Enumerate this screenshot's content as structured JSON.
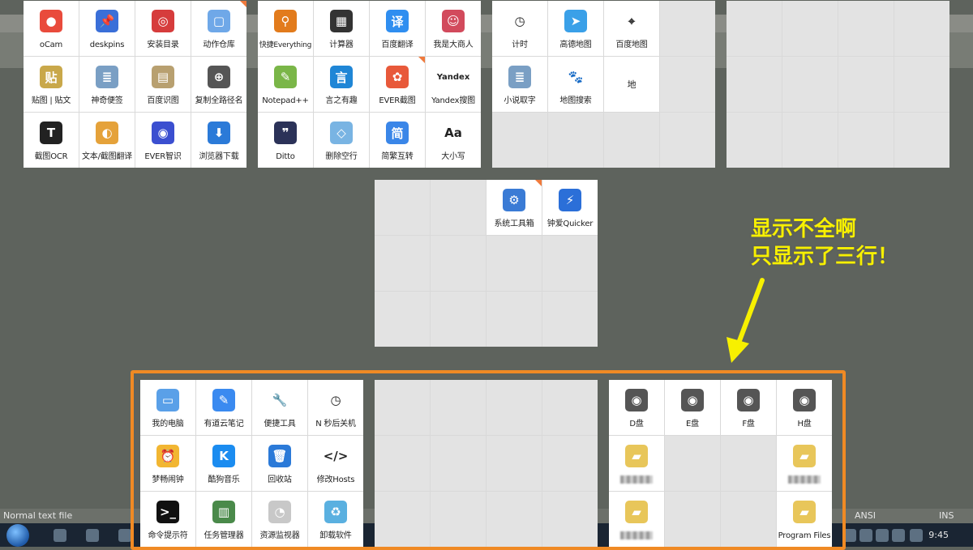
{
  "background": {
    "status_left": "Normal text file",
    "status_ansi": "ANSI",
    "status_ins": "INS",
    "clock": "9:45"
  },
  "panels": [
    {
      "id": "p1",
      "cols": 4,
      "rows": 3,
      "cells": [
        {
          "label": "oCam",
          "icon": "ocam-icon",
          "bg": "#e94b3c",
          "glyph": "●"
        },
        {
          "label": "deskpins",
          "icon": "pin-icon",
          "bg": "#3a6fd8",
          "glyph": "📌"
        },
        {
          "label": "安装目录",
          "icon": "install-icon",
          "bg": "#d63c3c",
          "glyph": "◎"
        },
        {
          "label": "动作仓库",
          "icon": "repo-icon",
          "bg": "#6fa8e8",
          "glyph": "▢",
          "corner": true
        },
        {
          "label": "贴图 | 贴文",
          "icon": "sticker-icon",
          "bg": "#c9a84a",
          "glyph": "贴"
        },
        {
          "label": "神奇便签",
          "icon": "note-icon",
          "bg": "#7a9fc4",
          "glyph": "≣"
        },
        {
          "label": "百度识图",
          "icon": "baidu-image-icon",
          "bg": "#b8a070",
          "glyph": "▤"
        },
        {
          "label": "复制全路径名",
          "icon": "copy-path-icon",
          "bg": "#555",
          "glyph": "⊕"
        },
        {
          "label": "截图OCR",
          "icon": "ocr-icon",
          "bg": "#222",
          "glyph": "T"
        },
        {
          "label": "文本/截图翻译",
          "icon": "translate-icon",
          "bg": "#e5a23a",
          "glyph": "◐"
        },
        {
          "label": "EVER智识",
          "icon": "ever-icon",
          "bg": "#3b4fd0",
          "glyph": "◉"
        },
        {
          "label": "浏览器下载",
          "icon": "download-icon",
          "bg": "#2b7ad8",
          "glyph": "⬇"
        }
      ]
    },
    {
      "id": "p2",
      "cols": 4,
      "rows": 3,
      "cells": [
        {
          "label": "快捷Everything",
          "icon": "everything-icon",
          "bg": "#e27b1c",
          "glyph": "⚲",
          "small": true
        },
        {
          "label": "计算器",
          "icon": "calculator-icon",
          "bg": "#333",
          "glyph": "▦"
        },
        {
          "label": "百度翻译",
          "icon": "baidu-translate-icon",
          "bg": "#2f8ef0",
          "glyph": "译"
        },
        {
          "label": "我是大商人",
          "icon": "merchant-icon",
          "bg": "#d24a5c",
          "glyph": "☺"
        },
        {
          "label": "Notepad++",
          "icon": "notepadpp-icon",
          "bg": "#7ab648",
          "glyph": "✎"
        },
        {
          "label": "言之有趣",
          "icon": "quote-icon",
          "bg": "#1f86d6",
          "glyph": "言"
        },
        {
          "label": "EVER截图",
          "icon": "ever-screenshot-icon",
          "bg": "#e8593a",
          "glyph": "✿",
          "corner": true
        },
        {
          "label": "Yandex搜图",
          "icon": "yandex-icon",
          "bg": "#ffffff",
          "glyph": "Yandex",
          "dark": true
        },
        {
          "label": "Ditto",
          "icon": "ditto-icon",
          "bg": "#2b3258",
          "glyph": "❞"
        },
        {
          "label": "删除空行",
          "icon": "eraser-icon",
          "bg": "#79b4e3",
          "glyph": "◇"
        },
        {
          "label": "简繁互转",
          "icon": "convert-icon",
          "bg": "#3a86e8",
          "glyph": "简"
        },
        {
          "label": "大小写",
          "icon": "case-icon",
          "bg": "#ffffff",
          "glyph": "Aa",
          "dark": true
        }
      ]
    },
    {
      "id": "p3",
      "cols": 4,
      "rows": 3,
      "cells": [
        {
          "label": "计时",
          "icon": "clock-icon",
          "bg": "#ffffff",
          "glyph": "◷",
          "dark": true
        },
        {
          "label": "高德地图",
          "icon": "amap-icon",
          "bg": "#3aa0e8",
          "glyph": "➤"
        },
        {
          "label": "百度地图",
          "icon": "baidu-map-icon",
          "bg": "#ffffff",
          "glyph": "⌖",
          "dark": true
        },
        {
          "empty": true
        },
        {
          "label": "小说取字",
          "icon": "novel-icon",
          "bg": "#7a9fc4",
          "glyph": "≣"
        },
        {
          "label": "地图搜索",
          "icon": "map-search-icon",
          "bg": "#ffffff",
          "glyph": "🐾",
          "dark": true
        },
        {
          "label": "地",
          "textOnly": true
        },
        {
          "empty": true
        },
        {
          "empty": true
        },
        {
          "empty": true
        },
        {
          "empty": true
        },
        {
          "empty": true
        }
      ]
    },
    {
      "id": "p4",
      "cols": 4,
      "rows": 3,
      "cells": [
        {
          "empty": true
        },
        {
          "empty": true
        },
        {
          "empty": true
        },
        {
          "empty": true
        },
        {
          "empty": true
        },
        {
          "empty": true
        },
        {
          "empty": true
        },
        {
          "empty": true
        },
        {
          "empty": true
        },
        {
          "empty": true
        },
        {
          "empty": true
        },
        {
          "empty": true
        }
      ]
    },
    {
      "id": "p5",
      "cols": 4,
      "rows": 3,
      "cells": [
        {
          "empty": true
        },
        {
          "empty": true
        },
        {
          "label": "系统工具箱",
          "icon": "system-tools-icon",
          "bg": "#3a7bd5",
          "glyph": "⚙",
          "corner": true
        },
        {
          "label": "钟爱Quicker",
          "icon": "quicker-icon",
          "bg": "#2b6fd8",
          "glyph": "⚡"
        },
        {
          "empty": true
        },
        {
          "empty": true
        },
        {
          "empty": true
        },
        {
          "empty": true
        },
        {
          "empty": true
        },
        {
          "empty": true
        },
        {
          "empty": true
        },
        {
          "empty": true
        }
      ]
    },
    {
      "id": "p6",
      "cols": 4,
      "rows": 3,
      "cells": [
        {
          "label": "我的电脑",
          "icon": "computer-icon",
          "bg": "#5aa0e8",
          "glyph": "▭"
        },
        {
          "label": "有道云笔记",
          "icon": "youdao-note-icon",
          "bg": "#3a8af0",
          "glyph": "✎"
        },
        {
          "label": "便捷工具",
          "icon": "wrench-icon",
          "bg": "#ffffff",
          "glyph": "🔧",
          "dark": true
        },
        {
          "label": "N 秒后关机",
          "icon": "shutdown-timer-icon",
          "bg": "#ffffff",
          "glyph": "◷",
          "dark": true
        },
        {
          "label": "梦畅闹钟",
          "icon": "alarm-icon",
          "bg": "#f2b632",
          "glyph": "⏰"
        },
        {
          "label": "酷狗音乐",
          "icon": "kugou-icon",
          "bg": "#1b8cf0",
          "glyph": "K"
        },
        {
          "label": "回收站",
          "icon": "recycle-bin-icon",
          "bg": "#2b7ad8",
          "glyph": "🗑"
        },
        {
          "label": "修改Hosts",
          "icon": "hosts-file-icon",
          "bg": "#ffffff",
          "glyph": "</>",
          "dark": true
        },
        {
          "label": "命令提示符",
          "icon": "cmd-icon",
          "bg": "#111",
          "glyph": ">_"
        },
        {
          "label": "任务管理器",
          "icon": "task-manager-icon",
          "bg": "#4a8a4a",
          "glyph": "▥"
        },
        {
          "label": "资源监视器",
          "icon": "resource-monitor-icon",
          "bg": "#c8c8c8",
          "glyph": "◔"
        },
        {
          "label": "卸载软件",
          "icon": "uninstall-icon",
          "bg": "#5ab0e0",
          "glyph": "♻"
        }
      ]
    },
    {
      "id": "p7",
      "cols": 4,
      "rows": 3,
      "cells": [
        {
          "empty": true
        },
        {
          "empty": true
        },
        {
          "empty": true
        },
        {
          "empty": true
        },
        {
          "empty": true
        },
        {
          "empty": true
        },
        {
          "empty": true
        },
        {
          "empty": true
        },
        {
          "empty": true
        },
        {
          "empty": true
        },
        {
          "empty": true
        },
        {
          "empty": true
        }
      ]
    },
    {
      "id": "p8",
      "cols": 4,
      "rows": 3,
      "cells": [
        {
          "label": "D盘",
          "icon": "disk-icon",
          "bg": "#555",
          "glyph": "◉"
        },
        {
          "label": "E盘",
          "icon": "disk-icon",
          "bg": "#555",
          "glyph": "◉"
        },
        {
          "label": "F盘",
          "icon": "disk-icon",
          "bg": "#555",
          "glyph": "◉"
        },
        {
          "label": "H盘",
          "icon": "disk-icon",
          "bg": "#555",
          "glyph": "◉"
        },
        {
          "icon": "folder-icon",
          "bg": "#e8c65a",
          "glyph": "▰",
          "blur": true
        },
        {
          "empty": true
        },
        {
          "empty": true
        },
        {
          "icon": "folder-icon",
          "bg": "#e8c65a",
          "glyph": "▰",
          "blur": true
        },
        {
          "icon": "folder-icon",
          "bg": "#e8c65a",
          "glyph": "▰",
          "blur": true
        },
        {
          "empty": true
        },
        {
          "empty": true
        },
        {
          "label": "Program Files",
          "icon": "folder-icon",
          "bg": "#e8c65a",
          "glyph": "▰"
        }
      ]
    }
  ],
  "annotation": {
    "line1": "显示不全啊",
    "line2": "只显示了三行！"
  }
}
